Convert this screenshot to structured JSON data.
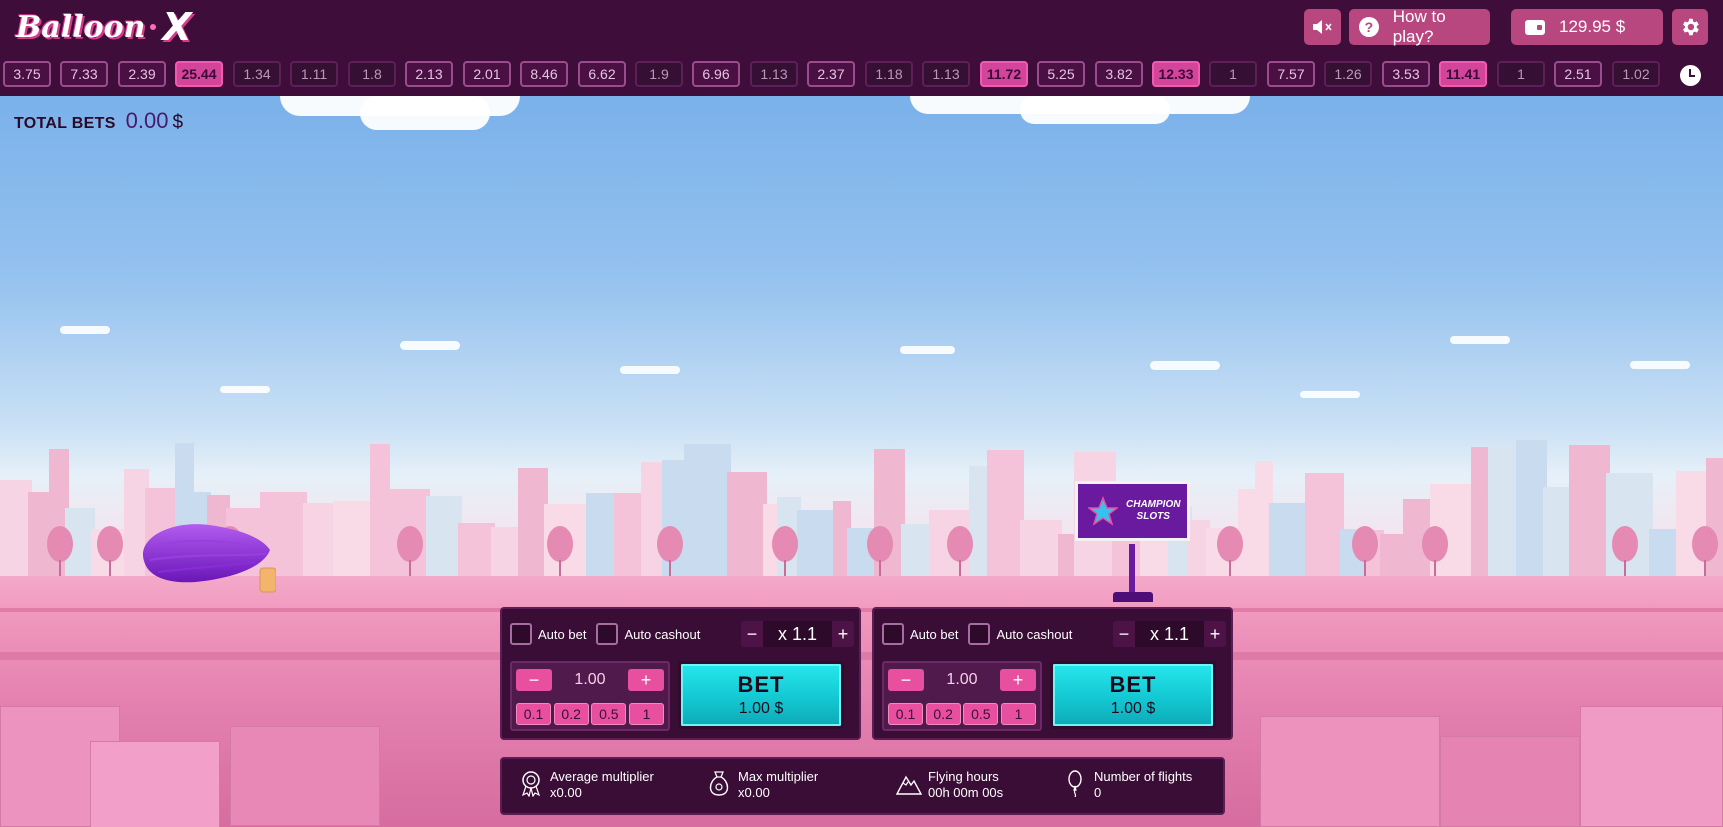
{
  "header": {
    "logo_text": "Balloon",
    "logo_x": "X",
    "how_to_play": "How to play?",
    "balance": "129.95 $"
  },
  "history": {
    "chips": [
      {
        "value": "3.75",
        "level": "mid"
      },
      {
        "value": "7.33",
        "level": "mid"
      },
      {
        "value": "2.39",
        "level": "mid"
      },
      {
        "value": "25.44",
        "level": "high"
      },
      {
        "value": "1.34",
        "level": "low"
      },
      {
        "value": "1.11",
        "level": "low"
      },
      {
        "value": "1.8",
        "level": "low"
      },
      {
        "value": "2.13",
        "level": "mid"
      },
      {
        "value": "2.01",
        "level": "mid"
      },
      {
        "value": "8.46",
        "level": "mid"
      },
      {
        "value": "6.62",
        "level": "mid"
      },
      {
        "value": "1.9",
        "level": "low"
      },
      {
        "value": "6.96",
        "level": "mid"
      },
      {
        "value": "1.13",
        "level": "low"
      },
      {
        "value": "2.37",
        "level": "mid"
      },
      {
        "value": "1.18",
        "level": "low"
      },
      {
        "value": "1.13",
        "level": "low"
      },
      {
        "value": "11.72",
        "level": "high"
      },
      {
        "value": "5.25",
        "level": "mid"
      },
      {
        "value": "3.82",
        "level": "mid"
      },
      {
        "value": "12.33",
        "level": "high"
      },
      {
        "value": "1",
        "level": "low"
      },
      {
        "value": "7.57",
        "level": "mid"
      },
      {
        "value": "1.26",
        "level": "low"
      },
      {
        "value": "3.53",
        "level": "mid"
      },
      {
        "value": "11.41",
        "level": "high"
      },
      {
        "value": "1",
        "level": "low"
      },
      {
        "value": "2.51",
        "level": "mid"
      },
      {
        "value": "1.02",
        "level": "low"
      }
    ]
  },
  "total_bets": {
    "label": "TOTAL BETS",
    "value": "0.00",
    "currency": "$"
  },
  "billboard": {
    "line1": "CHAMPION",
    "line2": "SLOTS"
  },
  "bet_panels": [
    {
      "auto_bet_label": "Auto bet",
      "auto_cashout_label": "Auto cashout",
      "multiplier": "x 1.1",
      "amount": "1.00",
      "quick_amounts": [
        "0.1",
        "0.2",
        "0.5",
        "1"
      ],
      "bet_label": "BET",
      "bet_amount": "1.00 $"
    },
    {
      "auto_bet_label": "Auto bet",
      "auto_cashout_label": "Auto cashout",
      "multiplier": "x 1.1",
      "amount": "1.00",
      "quick_amounts": [
        "0.1",
        "0.2",
        "0.5",
        "1"
      ],
      "bet_label": "BET",
      "bet_amount": "1.00 $"
    }
  ],
  "stats": {
    "average_multiplier_label": "Average multiplier",
    "average_multiplier_value": "x0.00",
    "max_multiplier_label": "Max multiplier",
    "max_multiplier_value": "x0.00",
    "flying_hours_label": "Flying hours",
    "flying_hours_value": "00h 00m 00s",
    "number_of_flights_label": "Number of flights",
    "number_of_flights_value": "0"
  },
  "colors": {
    "header_bg": "#3f0d3a",
    "accent_pink": "#e8509f",
    "bet_button": "#12c5d0",
    "balloon": "#8a2bd9"
  }
}
